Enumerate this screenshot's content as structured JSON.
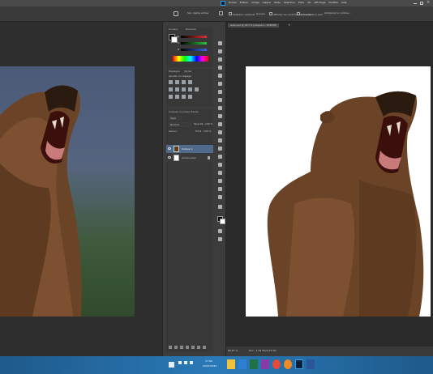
{
  "menu": {
    "items": [
      "Fichier",
      "Edition",
      "Image",
      "Calque",
      "Texte",
      "Sélection",
      "Filtre",
      "3D",
      "Affichage",
      "Fenêtre",
      "Aide"
    ]
  },
  "options": {
    "tool_dropdown": "Sél. rapide active",
    "checkbox1": "Sélection automatique",
    "dropdown": "Groupe",
    "checkbox2": "Afficher les contrôles de transf.",
    "checkbox3": "Accentuation automatique",
    "refine_button": "Améliorer le contour..."
  },
  "document_tab": {
    "title": "bear.psd @ 66,7% (Calque 1, RVB/8#)"
  },
  "color_panel": {
    "tabs": [
      "Couleur",
      "Nuancier"
    ],
    "channels": [
      "R",
      "V",
      "B"
    ]
  },
  "adjustments_panel": {
    "tabs": [
      "Réglages",
      "Styles"
    ],
    "heading": "Ajouter un réglage"
  },
  "layers_panel": {
    "tabs": [
      "Calques",
      "Couches",
      "Tracés"
    ],
    "kind": "Type",
    "blend_mode": "Normal",
    "opacity_label": "Opacité :",
    "opacity_value": "100 %",
    "lock_label": "Verrou :",
    "fill_label": "Fond :",
    "fill_value": "100 %",
    "layers": [
      {
        "name": "Calque 1",
        "selected": true
      },
      {
        "name": "Arrière-plan",
        "selected": false
      }
    ]
  },
  "status": {
    "zoom": "66,67 %",
    "doc_info": "Doc : 1,54 Mo/3,15 Mo"
  },
  "taskbar": {
    "time": "17:56",
    "date": "22/07/2015"
  }
}
